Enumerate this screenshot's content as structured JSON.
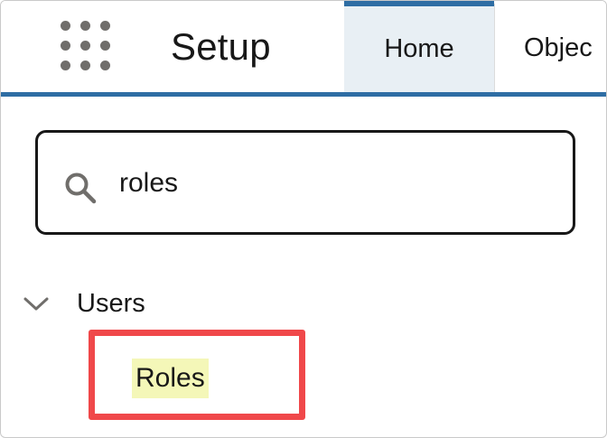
{
  "header": {
    "app_title": "Setup",
    "launcher_icon": "app-launcher-grid-icon",
    "tabs": [
      {
        "label": "Home",
        "active": true
      },
      {
        "label": "Objec",
        "active": false
      }
    ]
  },
  "search": {
    "icon": "search-icon",
    "value": "roles"
  },
  "tree": {
    "group": {
      "icon": "chevron-down-icon",
      "label": "Users",
      "expanded": true
    },
    "item": {
      "label": "Roles",
      "highlighted": true
    }
  },
  "colors": {
    "accent": "#2e6da4",
    "active_tab_bg": "#e8eff4",
    "annotation_border": "#f0484a",
    "match_highlight": "#f4f7b8",
    "icon_gray": "#706e6b"
  }
}
